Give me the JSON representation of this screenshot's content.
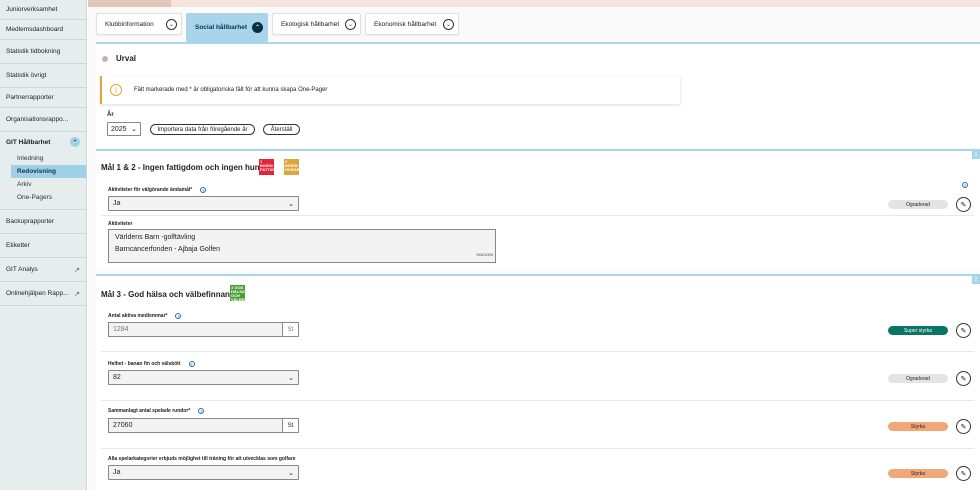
{
  "sidebar": {
    "items": [
      {
        "label": "Juniorverksamhet"
      },
      {
        "label": "Medlemsdashboard"
      },
      {
        "label": "Statistik tidbokning"
      },
      {
        "label": "Statistik övrigt"
      },
      {
        "label": "Partnerrapporter"
      },
      {
        "label": "Organisationsrappo..."
      }
    ],
    "group": {
      "label": "GIT Hållbarhet",
      "collapse_glyph": "⌃",
      "subitems": [
        "Inledning",
        "Redovisning",
        "Arkiv",
        "One-Pagers"
      ]
    },
    "items_after": [
      {
        "label": "Backuprapporter"
      },
      {
        "label": "Etiketter"
      },
      {
        "label": "GIT Analys",
        "external": "↗"
      },
      {
        "label": "Onlinehjälpen Rapp...",
        "external": "↗"
      }
    ]
  },
  "tabs": [
    {
      "label": "Klubbinformation",
      "chev": "⌄",
      "active": false
    },
    {
      "label": "Social hållbarhet",
      "chev": "⌃",
      "active": true
    },
    {
      "label": "Ekologisk hållbarhet",
      "chev": "⌄",
      "active": false
    },
    {
      "label": "Ekonomisk hållbarhet",
      "chev": "⌄",
      "active": false
    }
  ],
  "urval": {
    "title": "Urval",
    "info_icon": "i",
    "info_text": "Fält markerade med * är obligatoriska fält för att kunna skapa One-Pager",
    "year_label": "År",
    "year_value": "2025",
    "year_chev": "⌄",
    "import_button": "Importera data från föregående år",
    "reset_button": "Återställ"
  },
  "sections": {
    "s1": {
      "number": "1",
      "title": "Mål 1 & 2 - Ingen fattigdom och ingen hunger",
      "sdg_badges": [
        {
          "text": "1 INGEN FATTIGDOM",
          "color": "#e5243b"
        },
        {
          "text": "2 INGEN HUNGER",
          "color": "#dda63a"
        }
      ],
      "field1": {
        "label": "Aktiviteter för välgörande ändamål*",
        "value": "Ja",
        "status": "Ograderad"
      },
      "field2": {
        "label": "Aktiviteter",
        "lines": [
          "Världens Barn -golftävling",
          "Barncancerfonden - Ajbaja Golfen"
        ],
        "counter": "949/1000"
      }
    },
    "s2": {
      "number": "2",
      "title": "Mål 3 - God hälsa och välbefinnande",
      "sdg_badges": [
        {
          "text": "3 GOD HÄLSA OCH VÄLBEFINNANDE",
          "color": "#4c9f38"
        }
      ],
      "fields": [
        {
          "label": "Antal aktiva medlemmar*",
          "value": "1284",
          "unit": "St",
          "status": "Super styrka",
          "status_type": "teal",
          "kind": "number",
          "muted": true
        },
        {
          "label": "Helhet - banan fin och välskött",
          "value": "82",
          "status": "Ograderad",
          "status_type": "grey",
          "kind": "select"
        },
        {
          "label": "Sammanlagt antal spelade rundor*",
          "value": "27060",
          "unit": "St",
          "status": "Styrka",
          "status_type": "orange",
          "kind": "number"
        },
        {
          "label": "Alla spelarkategorier erbjuds möjlighet till träning för att utvecklas som golfare",
          "value": "Ja",
          "status": "Styrka",
          "status_type": "orange",
          "kind": "select"
        }
      ]
    }
  },
  "icons": {
    "question": "?",
    "edit": "✎",
    "select_chev": "⌄"
  },
  "colors": {
    "accent": "#a9d5ea",
    "teal": "#0b7565",
    "orange": "#f0a878",
    "warning": "#e6a33c"
  }
}
